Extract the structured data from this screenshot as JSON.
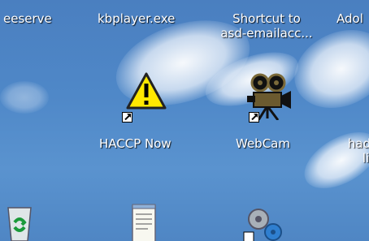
{
  "desktop": {
    "top_row": [
      {
        "label": "eeserve"
      },
      {
        "label": "kbplayer.exe"
      },
      {
        "label_line1": "Shortcut to",
        "label_line2": "asd-emailacc..."
      },
      {
        "label": "Adol"
      }
    ],
    "middle_row": [
      {
        "label": "HACCP Now",
        "icon": "warning-icon"
      },
      {
        "label": "WebCam",
        "icon": "movie-camera-icon"
      },
      {
        "label_line1": "had",
        "label_line2": "li",
        "icon": "unknown-icon"
      }
    ],
    "bottom_row": [
      {
        "icon": "recycle-bin-icon"
      },
      {
        "icon": "notepad-icon"
      },
      {
        "icon": "settings-gears-icon"
      }
    ]
  },
  "colors": {
    "sky": "#4f88c8",
    "label_text": "#ffffff",
    "warning_yellow": "#ffe800"
  }
}
